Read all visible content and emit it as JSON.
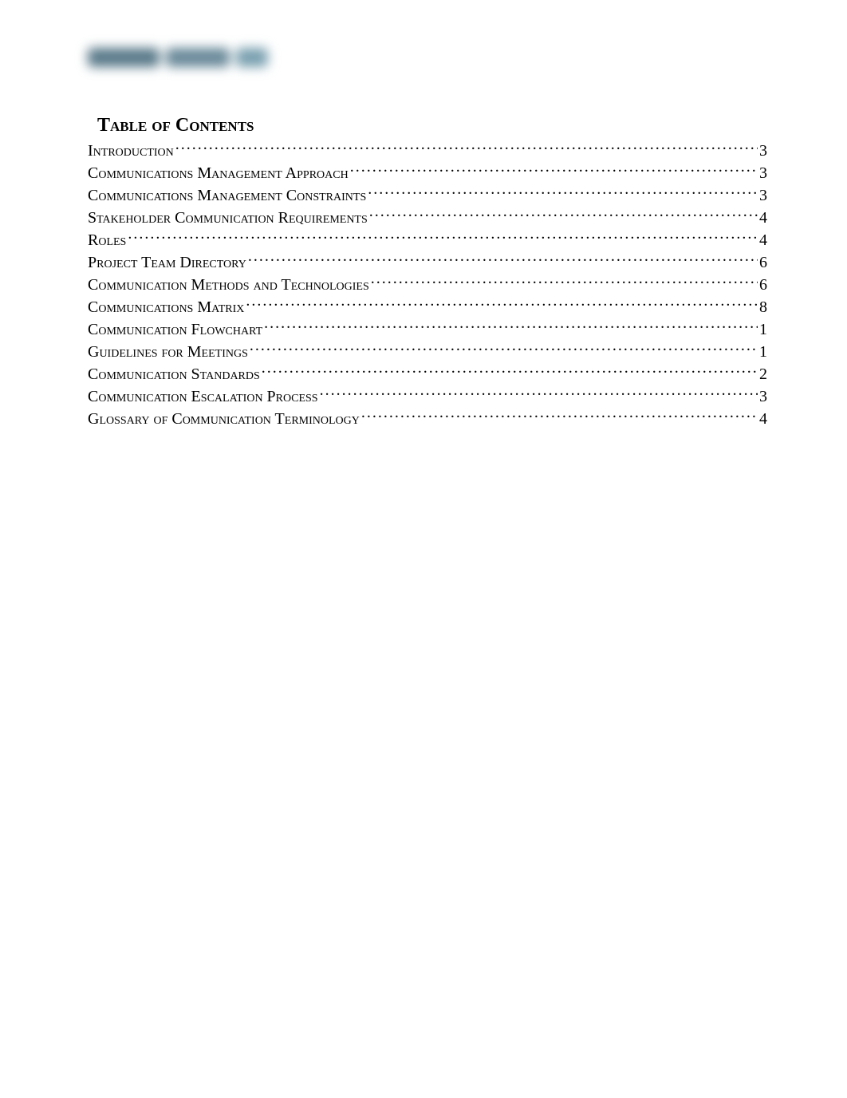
{
  "toc": {
    "title": "Table of Contents",
    "entries": [
      {
        "label": "Introduction",
        "page": "3"
      },
      {
        "label": "Communications Management Approach",
        "page": "3"
      },
      {
        "label": "Communications Management Constraints",
        "page": "3"
      },
      {
        "label": "Stakeholder Communication Requirements",
        "page": "4"
      },
      {
        "label": "Roles",
        "page": "4"
      },
      {
        "label": "Project Team Directory",
        "page": "6"
      },
      {
        "label": "Communication Methods and Technologies",
        "page": "6"
      },
      {
        "label": "Communications Matrix",
        "page": "8"
      },
      {
        "label": "Communication Flowchart",
        "page": "1"
      },
      {
        "label": "Guidelines for Meetings",
        "page": "1"
      },
      {
        "label": "Communication Standards",
        "page": "2"
      },
      {
        "label": "Communication Escalation Process",
        "page": "3"
      },
      {
        "label": "Glossary of Communication Terminology",
        "page": "4"
      }
    ]
  }
}
